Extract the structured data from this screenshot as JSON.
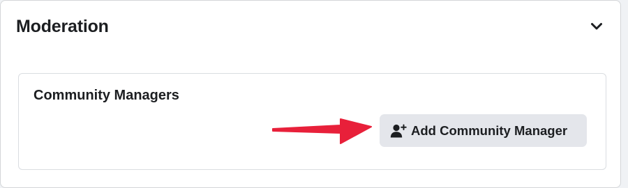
{
  "section": {
    "title": "Moderation",
    "collapse_icon": "chevron-down-icon"
  },
  "card": {
    "title": "Community Managers",
    "add_button": {
      "label": "Add Community Manager",
      "icon": "add-person-icon"
    }
  },
  "annotation": {
    "arrow_icon": "red-arrow-icon",
    "color": "#e8203a"
  },
  "colors": {
    "page_background": "#f0f2f5",
    "panel_background": "#ffffff",
    "button_background": "#e4e6eb",
    "text": "#1c1e21"
  }
}
